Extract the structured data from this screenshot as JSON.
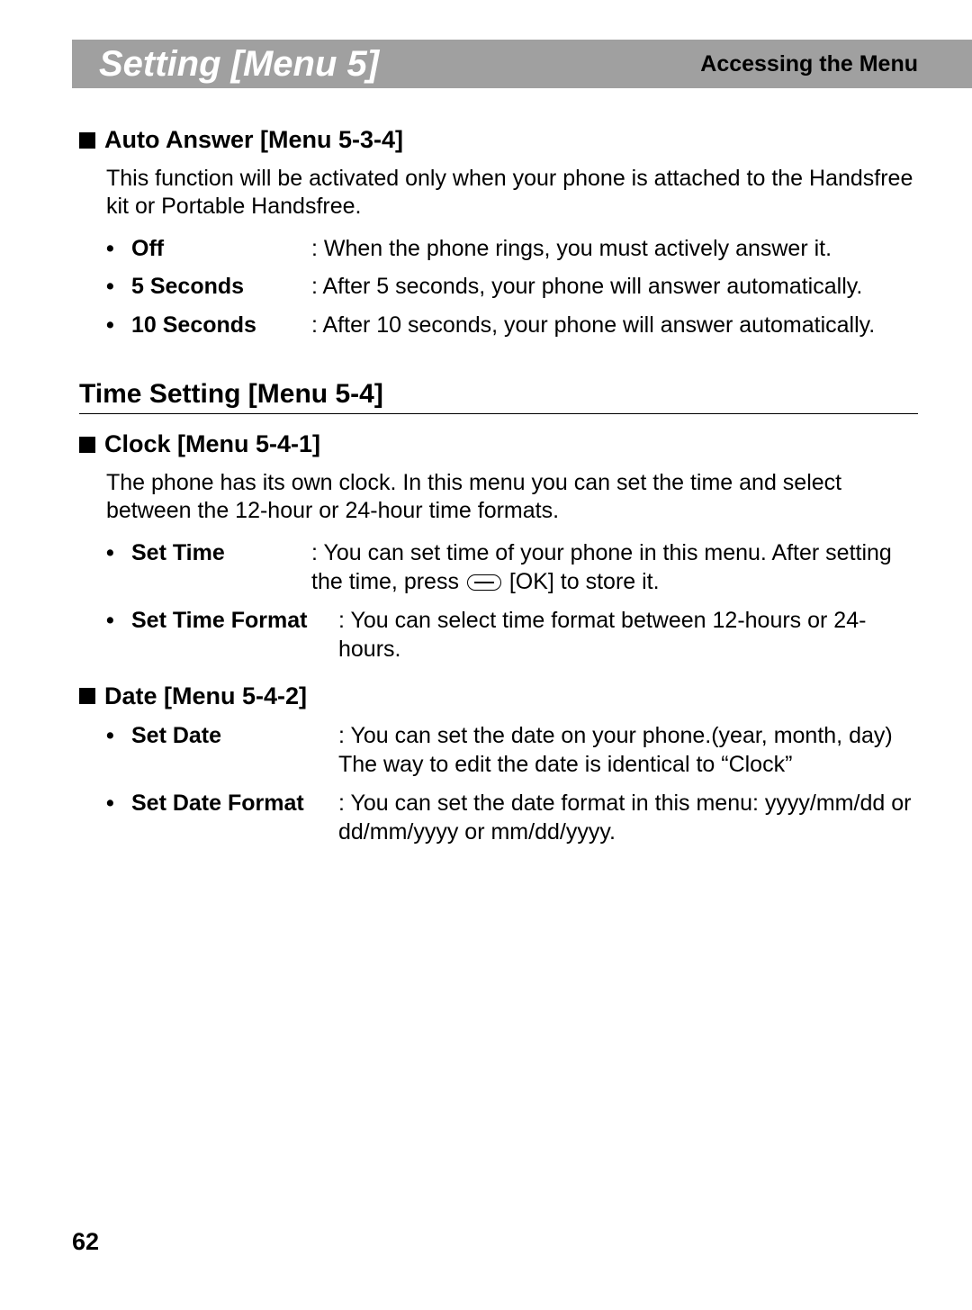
{
  "header": {
    "title": "Setting [Menu 5]",
    "subtitle": "Accessing the Menu"
  },
  "autoAnswer": {
    "heading": "Auto Answer [Menu 5-3-4]",
    "body": "This function will be activated only when your phone is attached to the Handsfree kit or Portable Handsfree.",
    "options": {
      "off": {
        "label": "Off",
        "desc": ": When the phone rings, you must actively answer it."
      },
      "sec5": {
        "label": "5 Seconds",
        "desc": ": After 5 seconds, your phone will answer automatically."
      },
      "sec10": {
        "label": "10 Seconds",
        "desc": ": After 10 seconds, your phone will answer automatically."
      }
    }
  },
  "timeSetting": {
    "heading": "Time Setting [Menu 5-4]",
    "clock": {
      "heading": "Clock [Menu 5-4-1]",
      "body": "The phone has its own clock. In this menu you can set the time and select between the 12-hour or 24-hour time formats.",
      "setTime": {
        "label": "Set Time",
        "desc1": ": You can set time of your phone in this menu. After setting the time, press ",
        "desc2": " [OK] to store it."
      },
      "setTimeFormat": {
        "label": "Set Time Format",
        "desc": ": You can select time format between 12-hours or 24-hours."
      }
    },
    "date": {
      "heading": "Date [Menu 5-4-2]",
      "setDate": {
        "label": "Set Date",
        "desc": ": You can set the date on your phone.(year, month, day) The way to edit the date is identical to “Clock”"
      },
      "setDateFormat": {
        "label": "Set Date Format",
        "desc": ": You can set the date format in this menu: yyyy/mm/dd or dd/mm/yyyy or mm/dd/yyyy."
      }
    }
  },
  "pageNumber": "62"
}
